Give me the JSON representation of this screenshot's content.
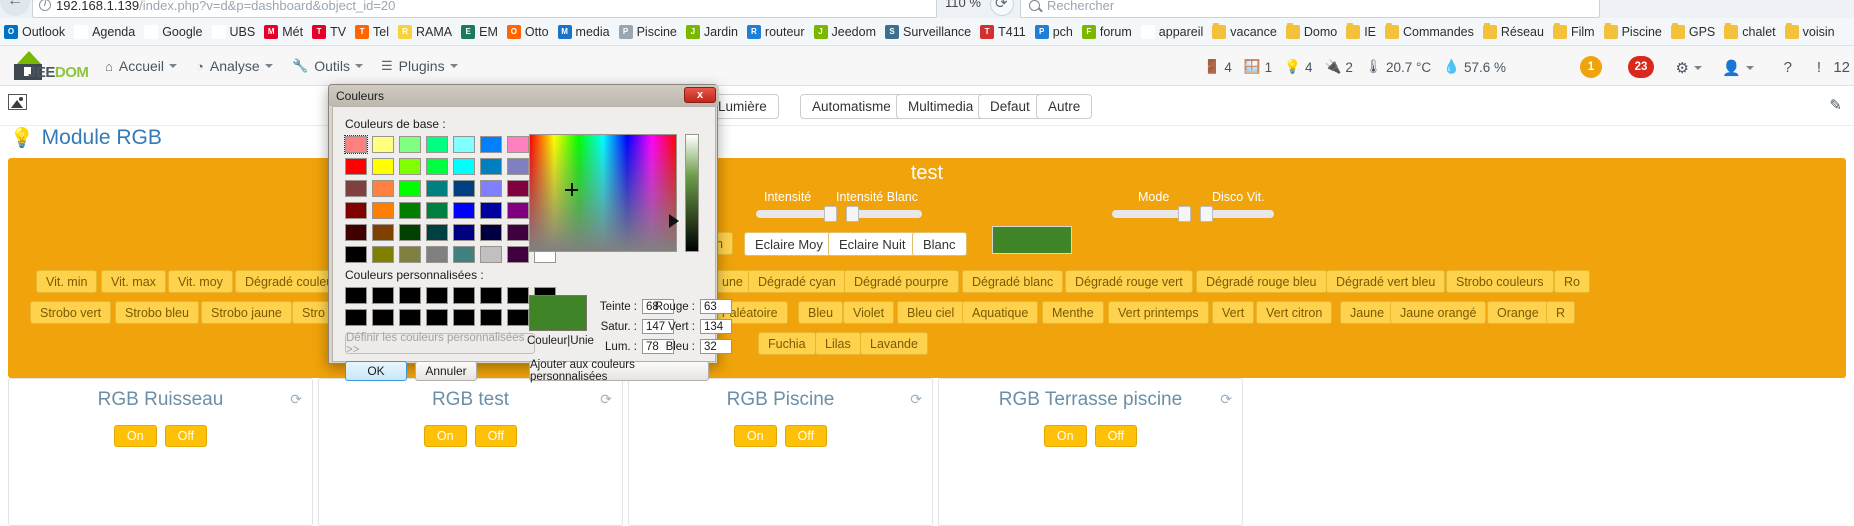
{
  "browser": {
    "url_host": "192.168.1.139",
    "url_path": "/index.php?v=d&p=dashboard&object_id=20",
    "zoom_level": "110 %",
    "search_placeholder": "Rechercher",
    "bookmarks": [
      {
        "label": "Outlook",
        "icon": "outlook-icon",
        "color": "#0072c6"
      },
      {
        "label": "Agenda",
        "icon": "google-agenda-icon",
        "color": "#ffffff"
      },
      {
        "label": "Google",
        "icon": "google-icon",
        "color": "#ffffff"
      },
      {
        "label": "UBS",
        "icon": "ubs-icon",
        "color": "#ffffff"
      },
      {
        "label": "Mét",
        "icon": "meteo-icon",
        "color": "#e4002b"
      },
      {
        "label": "TV",
        "icon": "tv-icon",
        "color": "#e4002b"
      },
      {
        "label": "Tel",
        "icon": "tel-icon",
        "color": "#ff6600"
      },
      {
        "label": "RAMA",
        "icon": "rama-icon",
        "color": "#f6d33c"
      },
      {
        "label": "EM",
        "icon": "em-icon",
        "color": "#1b7a5a"
      },
      {
        "label": "Otto",
        "icon": "otto-icon",
        "color": "#ff6600"
      },
      {
        "label": "media",
        "icon": "dsm-icon",
        "color": "#1a73c9"
      },
      {
        "label": "Piscine",
        "icon": "globe-icon",
        "color": "#9aa7b0"
      },
      {
        "label": "Jardin",
        "icon": "jardin-icon",
        "color": "#7ab800"
      },
      {
        "label": "routeur",
        "icon": "router-icon",
        "color": "#1f7fd4"
      },
      {
        "label": "Jeedom",
        "icon": "jeedom-icon",
        "color": "#7ab800"
      },
      {
        "label": "Surveillance",
        "icon": "camera-icon",
        "color": "#3f6f8f"
      },
      {
        "label": "T411",
        "icon": "t411-icon",
        "color": "#d32f2f"
      },
      {
        "label": "pch",
        "icon": "pch-icon",
        "color": "#1f7fd4"
      },
      {
        "label": "forum",
        "icon": "forum-icon",
        "color": "#7ab800"
      },
      {
        "label": "appareil",
        "icon": "google-icon",
        "color": "#ffffff"
      },
      {
        "label": "vacance",
        "icon": "folder-icon",
        "color": "#f3c13a"
      },
      {
        "label": "Domo",
        "icon": "folder-icon",
        "color": "#f3c13a"
      },
      {
        "label": "IE",
        "icon": "folder-icon",
        "color": "#f3c13a"
      },
      {
        "label": "Commandes",
        "icon": "folder-icon",
        "color": "#f3c13a"
      },
      {
        "label": "Réseau",
        "icon": "folder-icon",
        "color": "#f3c13a"
      },
      {
        "label": "Film",
        "icon": "folder-icon",
        "color": "#f3c13a"
      },
      {
        "label": "Piscine",
        "icon": "folder-icon",
        "color": "#f3c13a"
      },
      {
        "label": "GPS",
        "icon": "folder-icon",
        "color": "#f3c13a"
      },
      {
        "label": "chalet",
        "icon": "folder-icon",
        "color": "#f3c13a"
      },
      {
        "label": "voisin",
        "icon": "folder-icon",
        "color": "#f3c13a"
      }
    ]
  },
  "jeedom_nav": {
    "logo_part1": "JEE",
    "logo_part2": "DOM",
    "menu": [
      {
        "label": "Accueil",
        "icon": "home-icon"
      },
      {
        "label": "Analyse",
        "icon": "chart-icon"
      },
      {
        "label": "Outils",
        "icon": "wrench-icon"
      },
      {
        "label": "Plugins",
        "icon": "list-icon"
      }
    ],
    "stats": {
      "doors_icon": "door-icon",
      "doors": "4",
      "windows_icon": "window-icon",
      "windows": "1",
      "lights_icon": "bulb-icon",
      "lights": "4",
      "plugs_icon": "plug-icon",
      "plugs": "2",
      "temp_icon": "thermometer-icon",
      "temp": "20.7 °C",
      "humidity_icon": "droplet-icon",
      "humidity": "57.6 %"
    },
    "badge_orange": "1",
    "badge_red": "23",
    "icons": [
      "gears-icon",
      "user-icon",
      "help-icon",
      "info-icon"
    ],
    "clock": "12"
  },
  "page": {
    "image_icon": "image-icon",
    "pencil_icon": "pencil-icon",
    "tabs": [
      "Lumière",
      "Automatisme",
      "Multimedia",
      "Defaut",
      "Autre"
    ],
    "module_title": "Module RGB",
    "module_icon": "bulb-icon"
  },
  "panel": {
    "title": "test",
    "labels": {
      "intensite": "Intensité",
      "intensite_blanc": "Intensité Blanc",
      "mode": "Mode",
      "disco_vit": "Disco Vit."
    },
    "white_buttons": [
      "Eclaire Moy",
      "Eclaire Nuit",
      "Blanc"
    ],
    "hidden_button": "n",
    "swatch_color": "#3f8427",
    "row1": [
      "Vit. min",
      "Vit. max",
      "Vit. moy",
      "Dégradé couleurs",
      "une",
      "Dégradé cyan",
      "Dégradé pourpre",
      "Dégradé blanc",
      "Dégradé rouge vert",
      "Dégradé rouge bleu",
      "Dégradé vert bleu",
      "Strobo couleurs",
      "Ro"
    ],
    "row2": [
      "Strobo vert",
      "Strobo bleu",
      "Strobo jaune",
      "Stro",
      "r aléatoire",
      "Bleu",
      "Violet",
      "Bleu ciel",
      "Aquatique",
      "Menthe",
      "Vert printemps",
      "Vert",
      "Vert citron",
      "Jaune",
      "Jaune orangé",
      "Orange",
      "R"
    ],
    "row3": [
      "Fuchia",
      "Lilas",
      "Lavande"
    ]
  },
  "cards": [
    {
      "title": "RGB Ruisseau",
      "on": "On",
      "off": "Off",
      "refresh_icon": "refresh-icon"
    },
    {
      "title": "RGB test",
      "on": "On",
      "off": "Off",
      "refresh_icon": "refresh-icon"
    },
    {
      "title": "RGB Piscine",
      "on": "On",
      "off": "Off",
      "refresh_icon": "refresh-icon"
    },
    {
      "title": "RGB Terrasse piscine",
      "on": "On",
      "off": "Off",
      "refresh_icon": "refresh-icon"
    }
  ],
  "color_dialog": {
    "title": "Couleurs",
    "close_label": "x",
    "basic_label": "Couleurs de base :",
    "custom_label": "Couleurs personnalisées :",
    "define_button": "Définir les couleurs personnalisées >>",
    "ok_button": "OK",
    "cancel_button": "Annuler",
    "add_custom_button": "Ajouter aux couleurs personnalisées",
    "preview_label": "Couleur|Unie",
    "preview_color": "#3f8427",
    "fields": {
      "teinte_label": "Teinte :",
      "teinte_value": "68",
      "satur_label": "Satur. :",
      "satur_value": "147",
      "lum_label": "Lum. :",
      "lum_value": "78",
      "rouge_label": "Rouge :",
      "rouge_value": "63",
      "vert_label": "Vert :",
      "vert_value": "134",
      "bleu_label": "Bleu :",
      "bleu_value": "32"
    },
    "basic_colors": [
      "#ff8080",
      "#ffff80",
      "#80ff80",
      "#00ff80",
      "#80ffff",
      "#0080ff",
      "#ff80c0",
      "#ff80ff",
      "#ff0000",
      "#ffff00",
      "#80ff00",
      "#00ff40",
      "#00ffff",
      "#0080c0",
      "#8080c0",
      "#ff00ff",
      "#804040",
      "#ff8040",
      "#00ff00",
      "#008080",
      "#004080",
      "#8080ff",
      "#800040",
      "#ff0080",
      "#800000",
      "#ff8000",
      "#008000",
      "#008040",
      "#0000ff",
      "#0000a0",
      "#800080",
      "#8000ff",
      "#400000",
      "#804000",
      "#004000",
      "#004040",
      "#000080",
      "#000040",
      "#400040",
      "#400080",
      "#000000",
      "#808000",
      "#808040",
      "#808080",
      "#408080",
      "#c0c0c0",
      "#400040",
      "#ffffff"
    ],
    "custom_colors": [
      "#000000",
      "#000000",
      "#000000",
      "#000000",
      "#000000",
      "#000000",
      "#000000",
      "#000000",
      "#000000",
      "#000000",
      "#000000",
      "#000000",
      "#000000",
      "#000000",
      "#000000",
      "#000000"
    ]
  }
}
